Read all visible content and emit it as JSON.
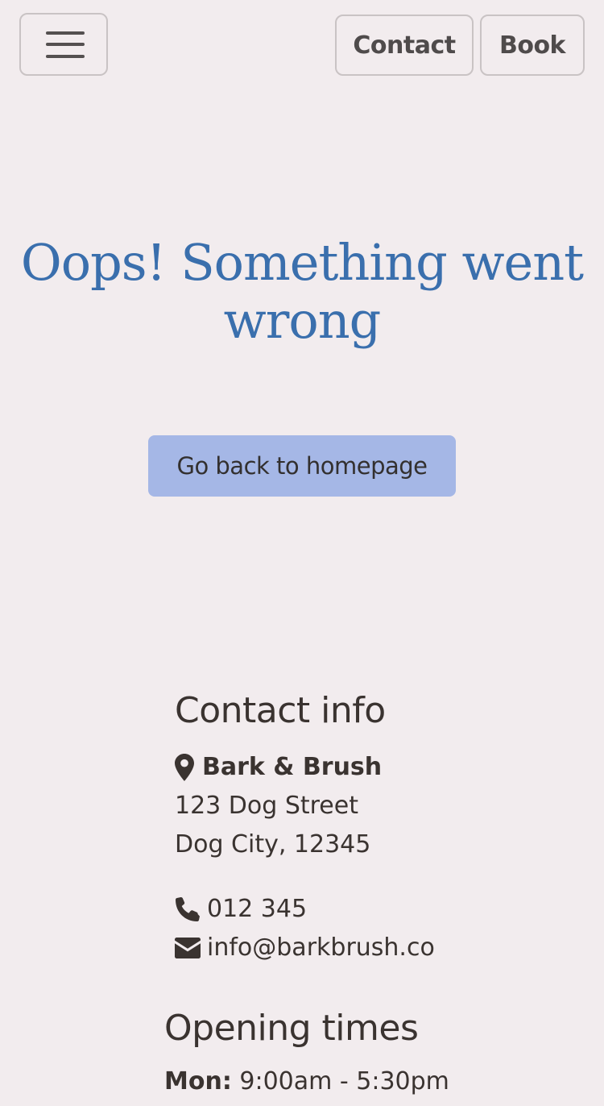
{
  "navbar": {
    "menu_toggle_label": "Toggle navigation",
    "contact_label": "Contact",
    "book_label": "Book"
  },
  "error": {
    "title": "Oops! Something went wrong",
    "home_button_label": "Go back to homepage"
  },
  "contact_info": {
    "heading": "Contact info",
    "business_name": "Bark & Brush",
    "address_line1": "123 Dog Street",
    "address_line2": "Dog City, 12345",
    "phone": "012 345",
    "email": "info@barkbrush.co",
    "icons": [
      "map-marker-icon",
      "phone-icon",
      "envelope-icon"
    ]
  },
  "opening_times": {
    "heading": "Opening times",
    "hours": [
      {
        "day": "Mon:",
        "time": "9:00am - 5:30pm"
      }
    ]
  },
  "colors": {
    "background": "#f2ecee",
    "title": "#3a6fad",
    "primary_button": "#a5b7e6",
    "text": "#3a3330"
  }
}
